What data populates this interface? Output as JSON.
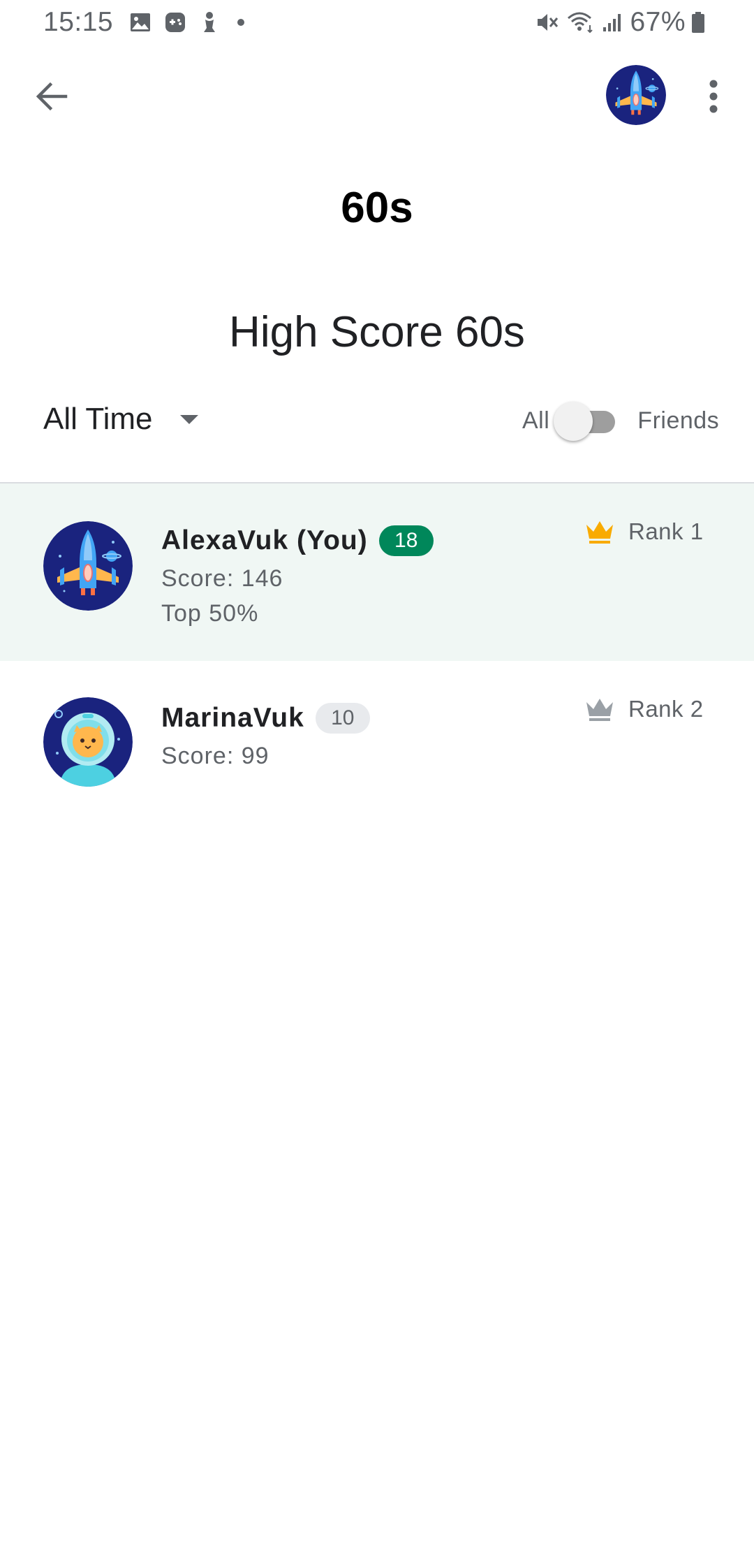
{
  "status_bar": {
    "time": "15:15",
    "battery": "67%",
    "icons": [
      "image-icon",
      "game-controller-icon",
      "chess-piece-icon",
      "dot-icon",
      "mute-icon",
      "wifi-icon",
      "signal-icon",
      "battery-icon"
    ]
  },
  "app_bar": {
    "back_icon": "arrow-back-icon",
    "menu_icon": "more-vert-icon"
  },
  "header": {
    "title": "60s",
    "leaderboard_title": "High Score 60s"
  },
  "filters": {
    "time_range": "All Time",
    "scope_left": "All",
    "scope_right": "Friends",
    "friends_only": false
  },
  "players": [
    {
      "name": "AlexaVuk (You)",
      "level": "18",
      "score": "Score: 146",
      "percentile": "Top 50%",
      "rank": "Rank 1",
      "crown_color": "#f9ab00",
      "avatar_icon": "spaceship-avatar-icon",
      "highlighted": true
    },
    {
      "name": "MarinaVuk",
      "level": "10",
      "score": "Score: 99",
      "rank": "Rank 2",
      "crown_color": "#9aa0a6",
      "avatar_icon": "astronaut-cat-avatar-icon",
      "highlighted": false
    }
  ],
  "colors": {
    "highlight_row": "#f0f7f4",
    "badge_green": "#00875a",
    "gold": "#f9ab00",
    "silver": "#9aa0a6"
  }
}
